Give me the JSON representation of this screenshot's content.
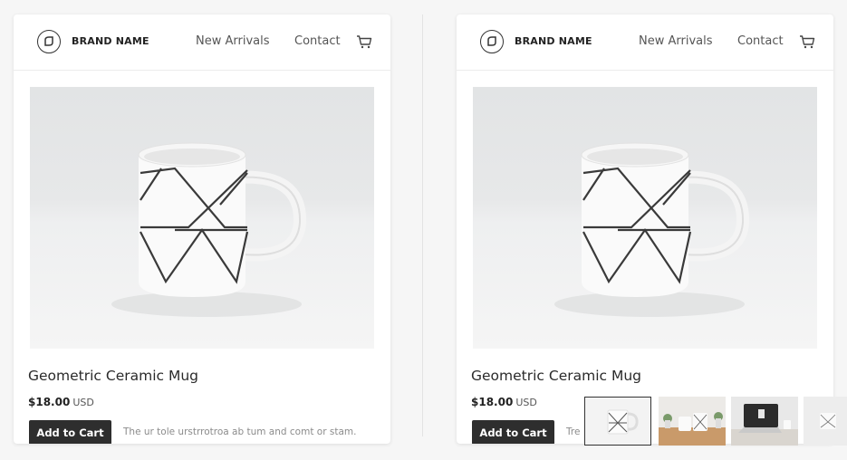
{
  "left_card": {
    "brand": "BRAND NAME",
    "nav": {
      "new_arrivals": "New Arrivals",
      "contact": "Contact"
    },
    "product": {
      "title": "Geometric Ceramic Mug",
      "price": "$18.00",
      "currency": "USD",
      "add_to_cart": "Add to Cart",
      "description": "The ur tole urstrrotroa ab tum and comt or stam."
    }
  },
  "right_card": {
    "brand": "BRAND NAME",
    "nav": {
      "new_arrivals": "New Arrivals",
      "contact": "Contact"
    },
    "product": {
      "title": "Geometric Ceramic Mug",
      "price": "$18.00",
      "currency": "USD",
      "add_to_cart": "Add to Cart",
      "description": "Tre"
    },
    "thumbnails": [
      "mug-front",
      "mugs-on-table",
      "laptop-on-desk",
      "mug-partial"
    ]
  },
  "icons": {
    "logo": "brand-logo-icon",
    "cart": "cart-icon"
  },
  "colors": {
    "button": "#2e2e2e",
    "card": "#ffffff",
    "background": "#f6f6f6",
    "selected_border": "#333333"
  }
}
